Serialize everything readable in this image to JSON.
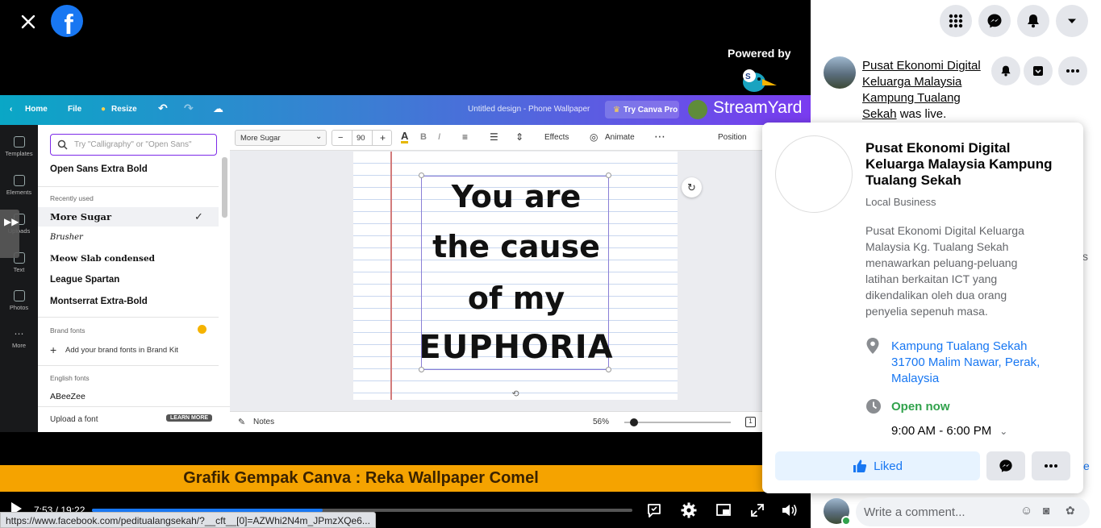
{
  "viewer": {
    "close_icon": "close-icon",
    "brand_icon": "facebook-logo-icon",
    "powered_by": "Powered by",
    "streamyard": "StreamYard",
    "canva": {
      "nav": [
        "Home",
        "File",
        "Resize"
      ],
      "title": "Untitled design - Phone Wallpaper",
      "try_pro": "Try Canva Pro",
      "rail": [
        "Templates",
        "Elements",
        "Uploads",
        "Text",
        "Photos",
        "More"
      ],
      "search_placeholder": "Try \"Calligraphy\" or \"Open Sans\"",
      "top_font": "Open Sans Extra Bold",
      "recently_used_label": "Recently used",
      "recent_fonts": [
        "More Sugar",
        "Brusher",
        "Meow Slab condensed",
        "League Spartan",
        "Montserrat Extra-Bold"
      ],
      "brand_fonts_label": "Brand fonts",
      "add_brand": "Add your brand fonts in Brand Kit",
      "english_fonts_label": "English fonts",
      "first_english": "ABeeZee",
      "upload_font": "Upload a font",
      "learn_more": "LEARN MORE",
      "toolbar": {
        "font": "More Sugar",
        "size": "90",
        "effects": "Effects",
        "animate": "Animate",
        "position": "Position"
      },
      "design_lines": [
        "You are",
        "the cause",
        "of my",
        "EUPHORIA"
      ],
      "notes": "Notes",
      "zoom": "56%",
      "page_count": "1"
    },
    "banner": "Grafik Gempak Canva : Reka Wallpaper Comel",
    "player": {
      "time": "7:53 / 19:22",
      "progress": 0.427
    },
    "status_url": "https://www.facebook.com/peditualangsekah/?__cft__[0]=AZWhi2N4m_JPmzXQe6..."
  },
  "sidebar": {
    "post": {
      "page_name": "Pusat Ekonomi Digital Keluarga Malaysia Kampung Tualang Sekah",
      "action": "was live."
    },
    "card": {
      "name": "Pusat Ekonomi Digital Keluarga Malaysia Kampung Tualang Sekah",
      "category": "Local Business",
      "description": "Pusat Ekonomi Digital Keluarga Malaysia Kg. Tualang Sekah menawarkan peluang-peluang latihan berkaitan ICT yang dikendalikan oleh dua orang penyelia sepenuh masa.",
      "address": "Kampung Tualang Sekah 31700 Malim Nawar, Perak, Malaysia",
      "open_status": "Open now",
      "hours": "9:00 AM - 6:00 PM",
      "liked_label": "Liked"
    },
    "comment_placeholder": "Write a comment...",
    "peek_right": "s",
    "peek_e": "e"
  },
  "colors": {
    "fb_blue": "#1877f2",
    "banner": "#f5a300",
    "open_green": "#31a24c"
  }
}
